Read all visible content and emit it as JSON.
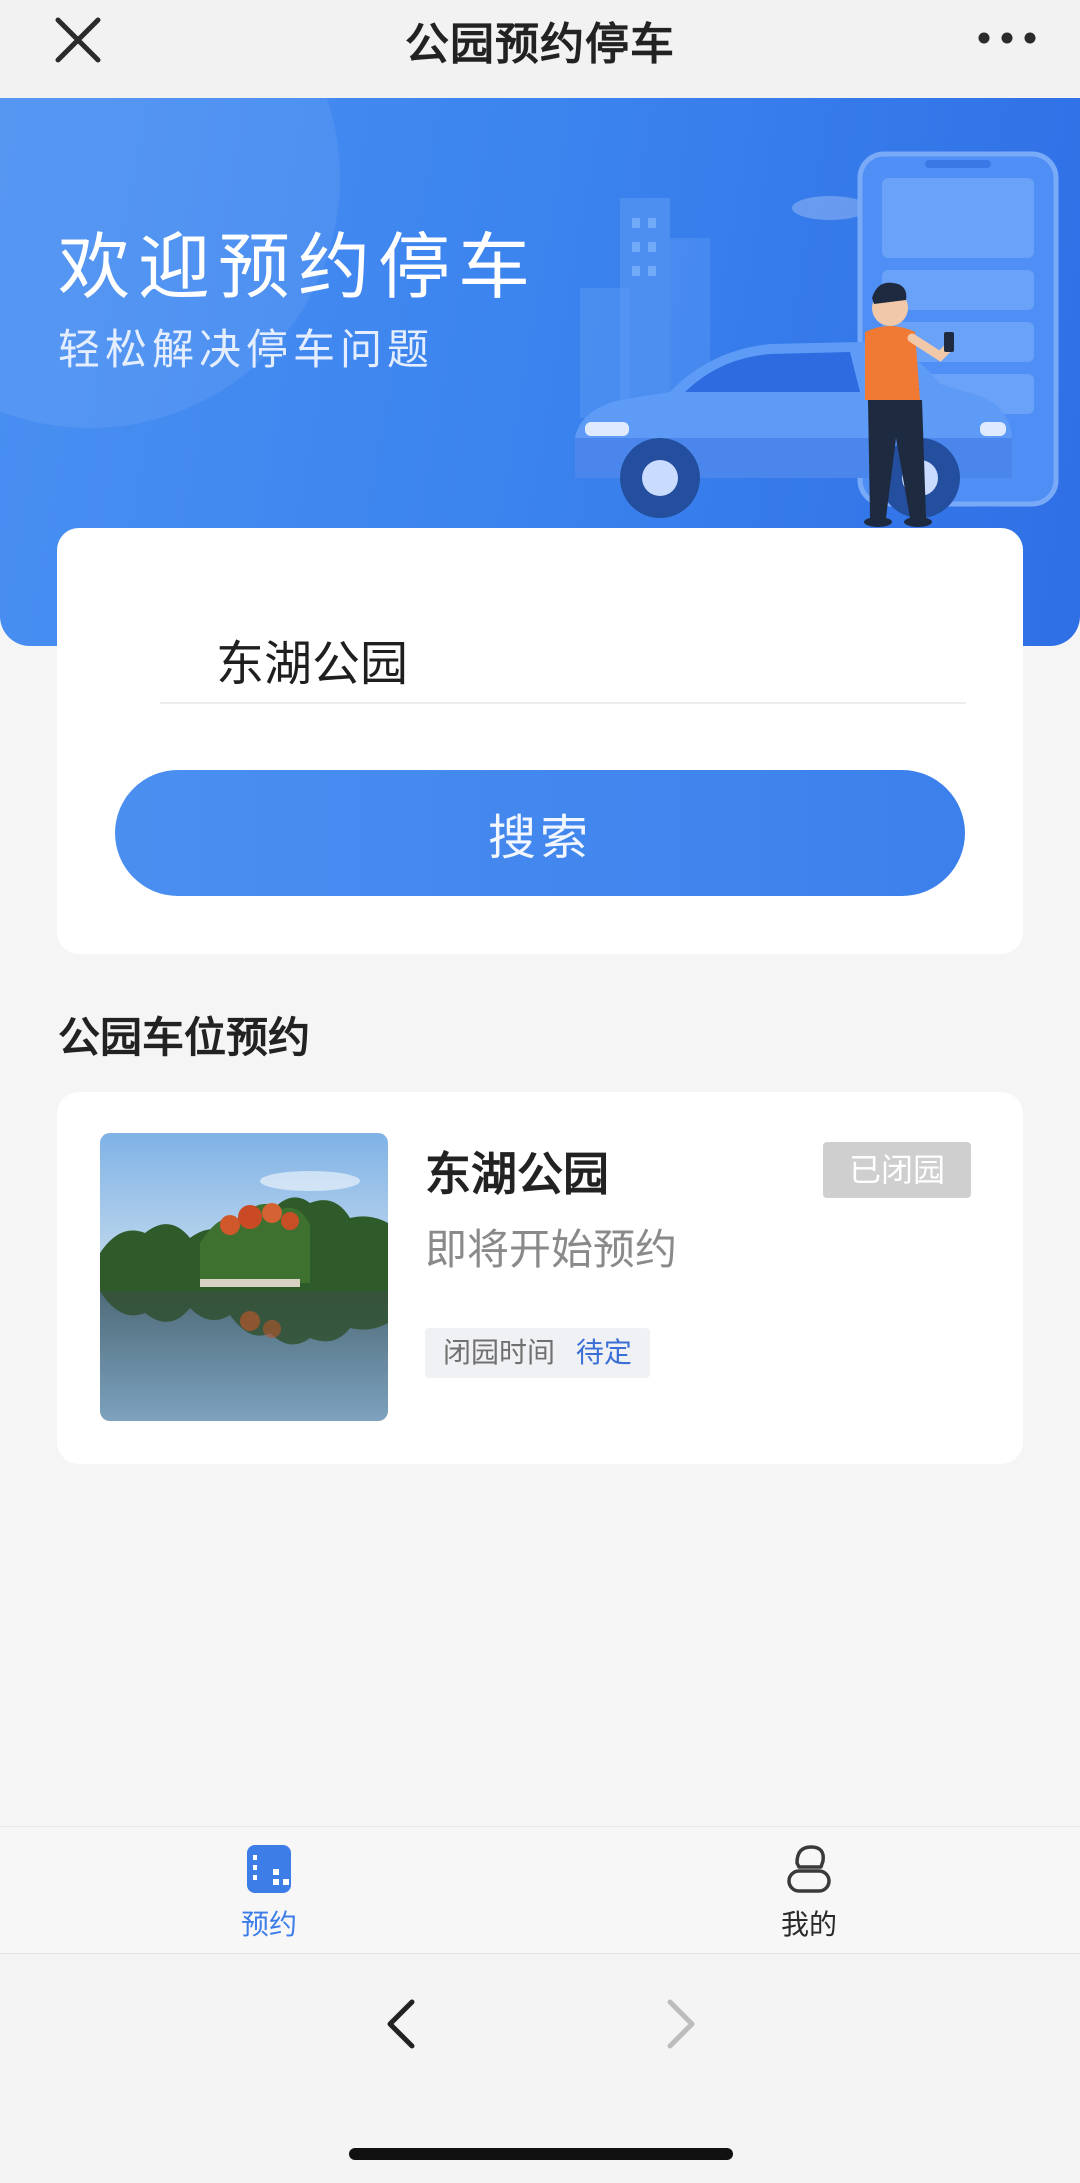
{
  "header": {
    "title": "公园预约停车",
    "close_icon": "close-icon",
    "more_icon": "more-icon"
  },
  "banner": {
    "title": "欢迎预约停车",
    "subtitle": "轻松解决停车问题",
    "illustration": "car-person-phone-illustration"
  },
  "search": {
    "value": "东湖公园",
    "button_label": "搜索"
  },
  "section": {
    "title": "公园车位预约"
  },
  "parks": [
    {
      "name": "东湖公园",
      "status": "即将开始预约",
      "badge": "已闭园",
      "close_time_label": "闭园时间",
      "close_time_value": "待定"
    }
  ],
  "tabbar": {
    "items": [
      {
        "label": "预约",
        "icon": "reserve-icon",
        "active": true
      },
      {
        "label": "我的",
        "icon": "profile-icon",
        "active": false
      }
    ]
  },
  "browser_nav": {
    "back_icon": "chevron-left-icon",
    "forward_icon": "chevron-right-icon"
  },
  "colors": {
    "accent": "#3d7de8",
    "banner_blue": "#3b83ee",
    "badge_gray": "#cfcfcf",
    "page_bg": "#f5f5f6"
  }
}
